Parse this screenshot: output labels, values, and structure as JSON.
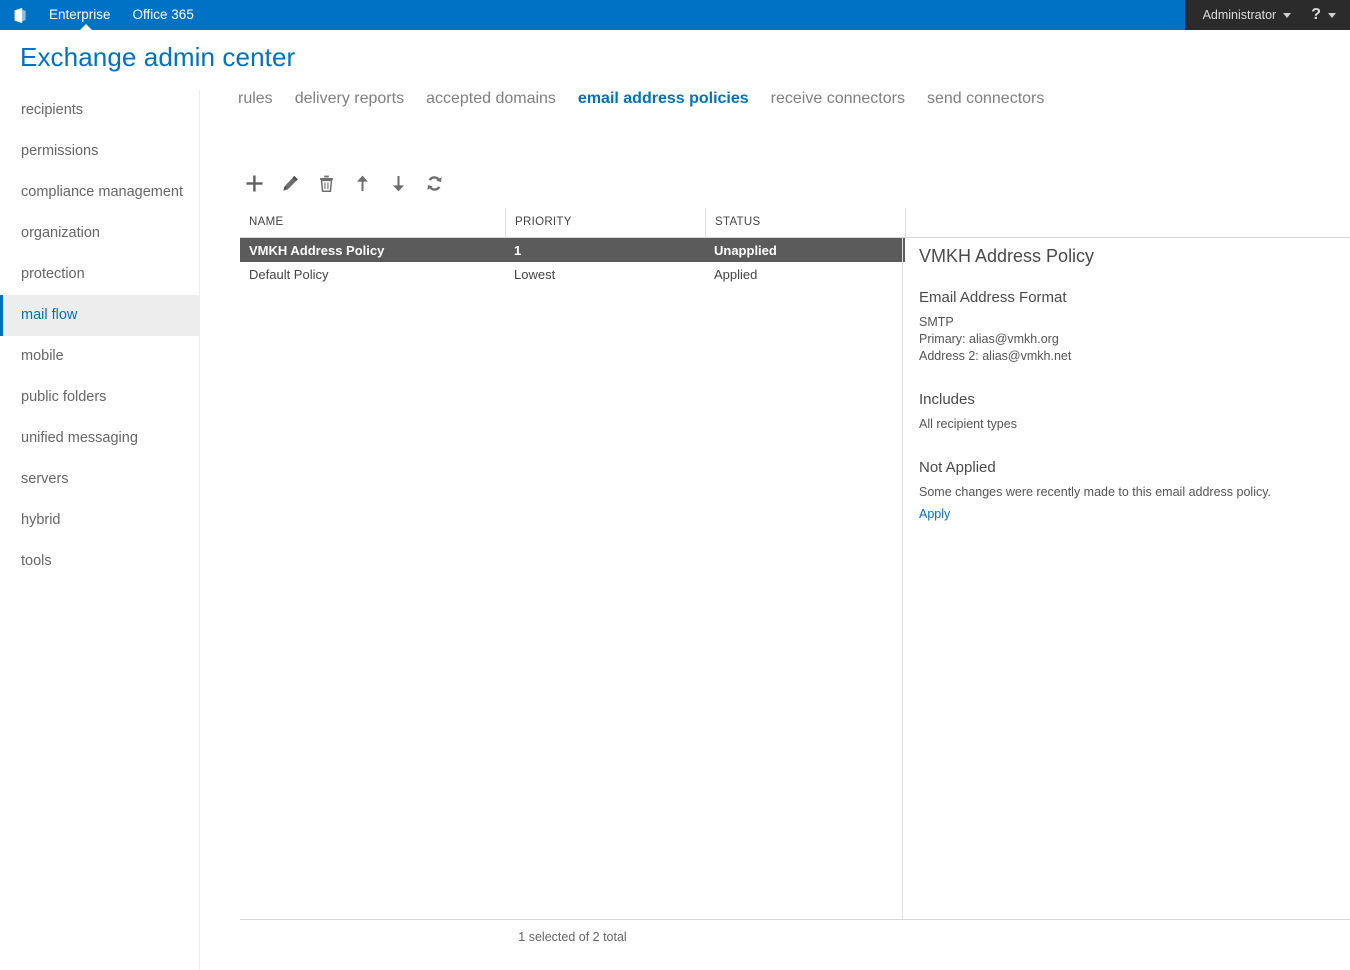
{
  "suite_bar": {
    "logo_icon": "office-logo-icon",
    "links": [
      {
        "label": "Enterprise",
        "active": true
      },
      {
        "label": "Office 365",
        "active": false
      }
    ],
    "user": "Administrator",
    "user_caret_icon": "chevron-down-icon",
    "help_glyph": "?",
    "help_caret_icon": "chevron-down-icon",
    "accent_color": "#0072c6",
    "right_panel_color": "#2b2b2b"
  },
  "page": {
    "title": "Exchange admin center",
    "title_color": "#0072c6"
  },
  "sidebar": {
    "items": [
      {
        "label": "recipients",
        "selected": false
      },
      {
        "label": "permissions",
        "selected": false
      },
      {
        "label": "compliance management",
        "selected": false
      },
      {
        "label": "organization",
        "selected": false
      },
      {
        "label": "protection",
        "selected": false
      },
      {
        "label": "mail flow",
        "selected": true
      },
      {
        "label": "mobile",
        "selected": false
      },
      {
        "label": "public folders",
        "selected": false
      },
      {
        "label": "unified messaging",
        "selected": false
      },
      {
        "label": "servers",
        "selected": false
      },
      {
        "label": "hybrid",
        "selected": false
      },
      {
        "label": "tools",
        "selected": false
      }
    ],
    "selected_color": "#0072c6"
  },
  "tabs": [
    {
      "label": "rules",
      "active": false
    },
    {
      "label": "delivery reports",
      "active": false
    },
    {
      "label": "accepted domains",
      "active": false
    },
    {
      "label": "email address policies",
      "active": true
    },
    {
      "label": "receive connectors",
      "active": false
    },
    {
      "label": "send connectors",
      "active": false
    }
  ],
  "toolbar": {
    "buttons": [
      {
        "name": "add-button",
        "icon": "plus-icon"
      },
      {
        "name": "edit-button",
        "icon": "pencil-icon"
      },
      {
        "name": "delete-button",
        "icon": "trash-icon"
      },
      {
        "name": "move-up-button",
        "icon": "arrow-up-icon"
      },
      {
        "name": "move-down-button",
        "icon": "arrow-down-icon"
      },
      {
        "name": "refresh-button",
        "icon": "refresh-icon"
      }
    ]
  },
  "table": {
    "columns": [
      "NAME",
      "PRIORITY",
      "STATUS"
    ],
    "rows": [
      {
        "name": "VMKH Address Policy",
        "priority": "1",
        "status": "Unapplied",
        "selected": true
      },
      {
        "name": "Default Policy",
        "priority": "Lowest",
        "status": "Applied",
        "selected": false
      }
    ],
    "selected_row_color": "#5b5b5b"
  },
  "details": {
    "title": "VMKH Address Policy",
    "format_heading": "Email Address Format",
    "format_protocol": "SMTP",
    "format_primary": "Primary: alias@vmkh.org",
    "format_address2": "Address 2: alias@vmkh.net",
    "includes_heading": "Includes",
    "includes_value": "All recipient types",
    "status_heading": "Not Applied",
    "status_description": "Some changes were recently made to this email address policy.",
    "apply_link": "Apply",
    "link_color": "#0072c6"
  },
  "footer": {
    "status": "1 selected of 2 total"
  }
}
